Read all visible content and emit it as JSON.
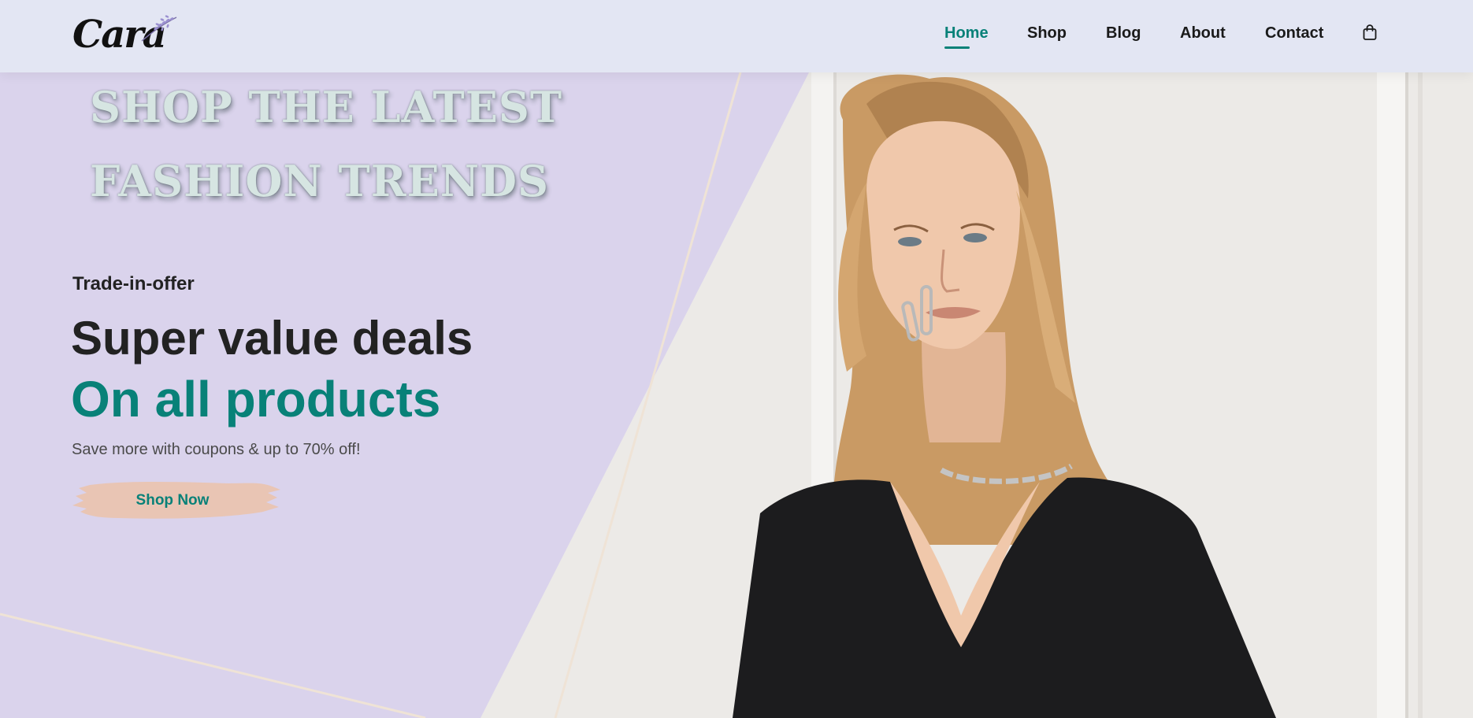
{
  "brand": {
    "name": "Cara",
    "accent_color": "#088178",
    "logo_icon": "lavender-sprig-icon"
  },
  "nav": {
    "items": [
      {
        "label": "Home",
        "active": true
      },
      {
        "label": "Shop",
        "active": false
      },
      {
        "label": "Blog",
        "active": false
      },
      {
        "label": "About",
        "active": false
      },
      {
        "label": "Contact",
        "active": false
      }
    ],
    "cart_icon": "shopping-bag-icon"
  },
  "hero": {
    "overlay_line1": "SHOP THE LATEST",
    "overlay_line2": "FASHION TRENDS",
    "tag": "Trade-in-offer",
    "headline": "Super value deals",
    "headline_accent": "On all products",
    "subtext": "Save more with coupons & up to 70% off!",
    "cta_label": "Shop Now",
    "cta_color": "#e9c5b4",
    "panel_color": "#dad3ec"
  }
}
